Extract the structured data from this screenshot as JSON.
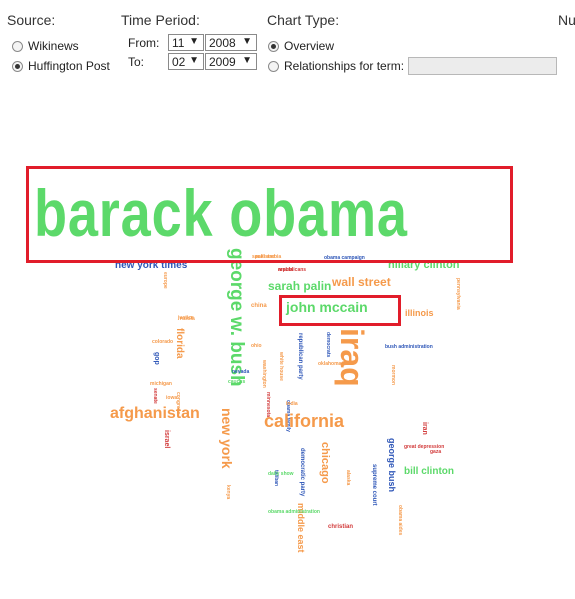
{
  "source": {
    "title": "Source:",
    "options": [
      {
        "label": "Wikinews",
        "selected": false
      },
      {
        "label": "Huffington Post",
        "selected": true
      }
    ]
  },
  "time_period": {
    "title": "Time Period:",
    "from_label": "From:",
    "to_label": "To:",
    "from_month": "11",
    "from_year": "2008",
    "to_month": "02",
    "to_year": "2009"
  },
  "chart_type": {
    "title": "Chart Type:",
    "overview_label": "Overview",
    "overview_selected": true,
    "relationships_label": "Relationships for term:",
    "relationships_selected": false,
    "term_value": ""
  },
  "cut_label": "Nu",
  "cloud": {
    "barack_obama": "barack obama",
    "john_mccain": "john mccain",
    "iraq": "iraq",
    "george_w_bush": "george w. bush",
    "sarah_palin": "sarah palin",
    "wall_street": "wall street",
    "hillary_clinton": "hillary clinton",
    "new_york_times": "new york times",
    "afghanistan": "afghanistan",
    "california": "california",
    "new_york": "new york",
    "chicago": "chicago",
    "bill_clinton": "bill clinton",
    "george_bush": "george bush",
    "illinois": "illinois",
    "florida": "florida",
    "middle_east": "middle east",
    "iran": "iran",
    "gop": "gop",
    "israel": "israel",
    "china": "china",
    "republican_party": "republican party",
    "democratic_party": "democratic party",
    "supreme_court": "supreme court",
    "bush_administration": "bush administration",
    "christian": "christian",
    "great_depression": "great depression",
    "ohio": "ohio",
    "iowa": "iowa",
    "russia": "russia",
    "europe": "europe",
    "obama_campaign": "obama campaign",
    "pennsylvania": "pennsylvania",
    "saudi_arabia": "saudi arabia",
    "washington": "washington",
    "senate": "senate",
    "congress": "congress",
    "pakistan": "pakistan",
    "arabia": "arabia",
    "india": "india",
    "caucus": "caucus",
    "democrats": "democrats",
    "white_house": "white house",
    "obama_administration": "obama administration",
    "minnesota": "minnesota",
    "justice": "justice",
    "republicans": "republicans",
    "mormon": "mormon",
    "obama_family": "obama family",
    "michigan": "michigan",
    "alaska": "alaska",
    "kenya": "kenya",
    "taliban": "taliban",
    "gaza": "gaza",
    "colorado": "colorado",
    "nevada": "nevada",
    "daily_show": "daily show",
    "oklahoma": "oklahoma",
    "obama_aides": "obama aides"
  }
}
